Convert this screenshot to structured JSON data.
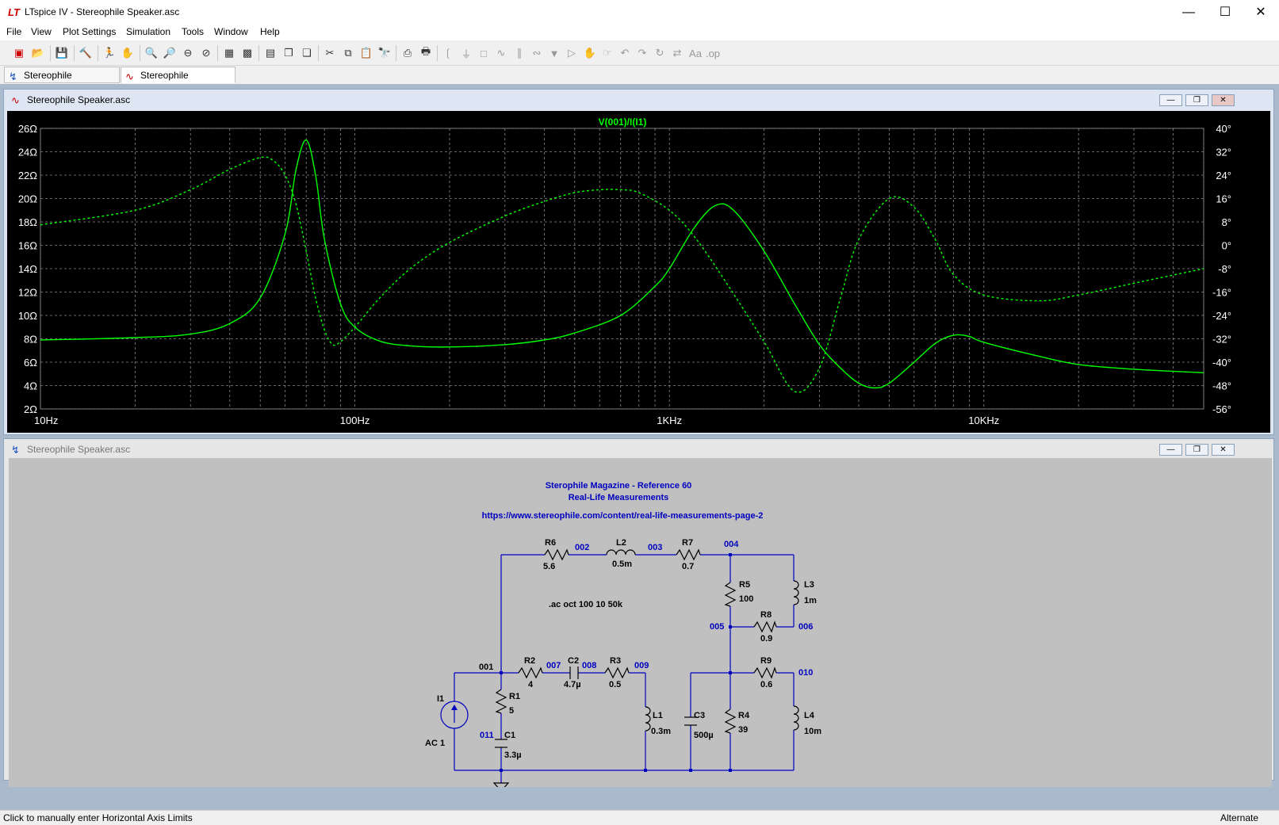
{
  "window": {
    "title": "LTspice IV - Stereophile Speaker.asc",
    "app_icon": "ltspice-logo-icon",
    "controls": [
      "minimize-icon",
      "maximize-icon",
      "close-icon"
    ]
  },
  "menu": [
    "File",
    "View",
    "Plot Settings",
    "Simulation",
    "Tools",
    "Window",
    "Help"
  ],
  "tabs": [
    {
      "label": "Stereophile Speaker.asc",
      "icon": "schematic-icon",
      "active": false
    },
    {
      "label": "Stereophile Speaker.asc",
      "icon": "waveform-icon",
      "active": true
    }
  ],
  "plot_window": {
    "title": "Stereophile Speaker.asc",
    "trace_label": "V(001)/I(I1)",
    "trace_color": "#00ff00"
  },
  "chart_data": {
    "type": "line",
    "xscale": "log",
    "xlim": [
      10,
      50000
    ],
    "x_ticks": [
      "10Hz",
      "100Hz",
      "1KHz",
      "10KHz"
    ],
    "ylim": [
      2,
      26
    ],
    "y_ticks": [
      "26Ω",
      "24Ω",
      "22Ω",
      "20Ω",
      "18Ω",
      "16Ω",
      "14Ω",
      "12Ω",
      "10Ω",
      "8Ω",
      "6Ω",
      "4Ω",
      "2Ω"
    ],
    "y2lim": [
      -56,
      40
    ],
    "y2_ticks": [
      "40°",
      "32°",
      "24°",
      "16°",
      "8°",
      "0°",
      "-8°",
      "-16°",
      "-24°",
      "-32°",
      "-40°",
      "-48°",
      "-56°"
    ],
    "grid": true,
    "series": [
      {
        "name": "V(001)/I(I1)",
        "style": "solid",
        "axis": "left",
        "x": [
          10,
          20,
          30,
          40,
          50,
          60,
          65,
          70,
          75,
          80,
          90,
          100,
          120,
          150,
          200,
          300,
          400,
          500,
          700,
          900,
          1000,
          1200,
          1400,
          1600,
          2000,
          2500,
          3000,
          3500,
          4000,
          4500,
          5000,
          6000,
          7000,
          8000,
          9000,
          10000,
          15000,
          20000,
          30000,
          50000
        ],
        "values": [
          7.9,
          8.1,
          8.4,
          9.3,
          11.5,
          17.0,
          22.5,
          25.0,
          22.0,
          16.5,
          11.0,
          9.0,
          7.8,
          7.4,
          7.3,
          7.5,
          7.9,
          8.5,
          10.0,
          12.5,
          14.0,
          17.5,
          19.4,
          19.0,
          15.5,
          11.0,
          7.5,
          5.5,
          4.2,
          3.8,
          4.2,
          6.0,
          7.6,
          8.3,
          8.2,
          7.7,
          6.5,
          5.8,
          5.4,
          5.1
        ]
      },
      {
        "name": "V(001)/I(I1) phase",
        "style": "dashed",
        "axis": "right",
        "x": [
          10,
          20,
          30,
          40,
          50,
          55,
          60,
          65,
          70,
          75,
          80,
          85,
          90,
          100,
          120,
          150,
          200,
          300,
          400,
          500,
          600,
          700,
          800,
          1000,
          1200,
          1500,
          2000,
          2500,
          3000,
          3500,
          4000,
          5000,
          6000,
          7000,
          8000,
          10000,
          15000,
          20000,
          30000,
          50000
        ],
        "values": [
          7,
          12,
          19,
          26,
          30,
          29,
          24,
          14,
          -2,
          -18,
          -29,
          -34,
          -33,
          -28,
          -18,
          -8,
          1,
          10,
          15,
          18,
          19,
          19,
          18,
          12,
          3,
          -12,
          -33,
          -50,
          -42,
          -18,
          2,
          16,
          13,
          2,
          -10,
          -17,
          -19,
          -17,
          -13,
          -8
        ]
      }
    ]
  },
  "schematic_window": {
    "title": "Stereophile Speaker.asc",
    "text_title1": "Sterophile Magazine - Reference 60",
    "text_title2": "Real-Life Measurements",
    "text_url": "https://www.stereophile.com/content/real-life-measurements-page-2",
    "directive": ".ac oct 100 10 50k",
    "components": [
      {
        "ref": "R6",
        "value": "5.6"
      },
      {
        "ref": "L2",
        "value": "0.5m"
      },
      {
        "ref": "R7",
        "value": "0.7"
      },
      {
        "ref": "R5",
        "value": "100"
      },
      {
        "ref": "L3",
        "value": "1m"
      },
      {
        "ref": "R8",
        "value": "0.9"
      },
      {
        "ref": "R2",
        "value": "4"
      },
      {
        "ref": "C2",
        "value": "4.7µ"
      },
      {
        "ref": "R3",
        "value": "0.5"
      },
      {
        "ref": "R9",
        "value": "0.6"
      },
      {
        "ref": "R1",
        "value": "5"
      },
      {
        "ref": "C1",
        "value": "3.3µ"
      },
      {
        "ref": "L1",
        "value": "0.3m"
      },
      {
        "ref": "C3",
        "value": "500µ"
      },
      {
        "ref": "R4",
        "value": "39"
      },
      {
        "ref": "L4",
        "value": "10m"
      },
      {
        "ref": "I1",
        "value": "AC 1"
      }
    ],
    "nets": [
      "001",
      "002",
      "003",
      "004",
      "005",
      "006",
      "007",
      "008",
      "009",
      "010",
      "011"
    ]
  },
  "status": {
    "left": "Click to manually enter Horizontal Axis Limits",
    "right": "Alternate"
  }
}
